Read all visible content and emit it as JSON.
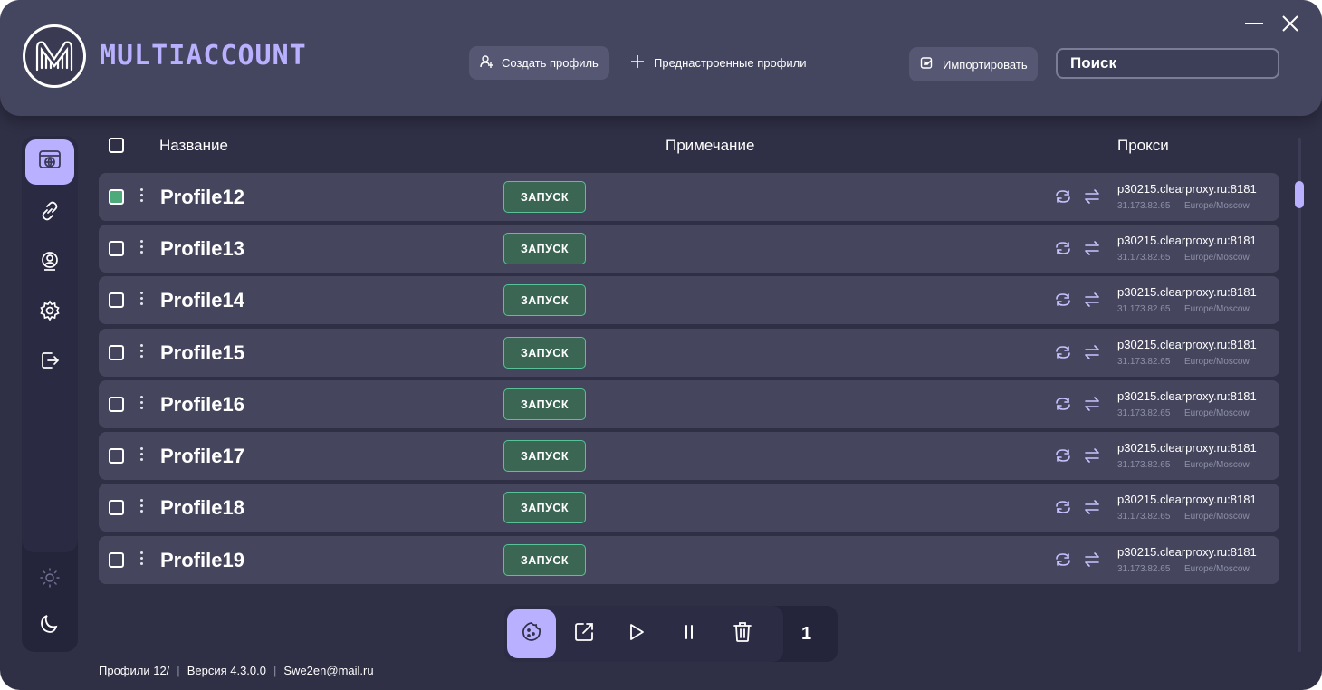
{
  "app": {
    "logo_icon": "fingerprint-m-logo",
    "logo_text": "MULTIACCOUNT",
    "accent_color": "#b9b0ff",
    "launch_color": "#58c196"
  },
  "header": {
    "create_profile_label": "Создать профиль",
    "create_profile_icon": "user-plus-icon",
    "presets_label": "Преднастроенные профили",
    "presets_icon": "plus-icon",
    "import_label": "Импортировать",
    "import_icon": "import-icon",
    "search_placeholder": "Поиск"
  },
  "sidebar": {
    "items": [
      {
        "icon": "browser-globe-icon",
        "active": true
      },
      {
        "icon": "link-icon",
        "active": false
      },
      {
        "icon": "user-bubble-icon",
        "active": false
      },
      {
        "icon": "gear-icon",
        "active": false
      },
      {
        "icon": "logout-icon",
        "active": false
      }
    ],
    "theme": [
      {
        "icon": "sun-icon"
      },
      {
        "icon": "moon-icon"
      }
    ]
  },
  "table": {
    "columns": {
      "name": "Название",
      "note": "Примечание",
      "proxy": "Прокси"
    },
    "rows": [
      {
        "name": "Profile12",
        "checked": true,
        "launch": "ЗАПУСК",
        "proxy_host": "p30215.clearproxy.ru:8181",
        "proxy_ip": "31.173.82.65",
        "proxy_tz": "Europe/Moscow"
      },
      {
        "name": "Profile13",
        "checked": false,
        "launch": "ЗАПУСК",
        "proxy_host": "p30215.clearproxy.ru:8181",
        "proxy_ip": "31.173.82.65",
        "proxy_tz": "Europe/Moscow"
      },
      {
        "name": "Profile14",
        "checked": false,
        "launch": "ЗАПУСК",
        "proxy_host": "p30215.clearproxy.ru:8181",
        "proxy_ip": "31.173.82.65",
        "proxy_tz": "Europe/Moscow"
      },
      {
        "name": "Profile15",
        "checked": false,
        "launch": "ЗАПУСК",
        "proxy_host": "p30215.clearproxy.ru:8181",
        "proxy_ip": "31.173.82.65",
        "proxy_tz": "Europe/Moscow"
      },
      {
        "name": "Profile16",
        "checked": false,
        "launch": "ЗАПУСК",
        "proxy_host": "p30215.clearproxy.ru:8181",
        "proxy_ip": "31.173.82.65",
        "proxy_tz": "Europe/Moscow"
      },
      {
        "name": "Profile17",
        "checked": false,
        "launch": "ЗАПУСК",
        "proxy_host": "p30215.clearproxy.ru:8181",
        "proxy_ip": "31.173.82.65",
        "proxy_tz": "Europe/Moscow"
      },
      {
        "name": "Profile18",
        "checked": false,
        "launch": "ЗАПУСК",
        "proxy_host": "p30215.clearproxy.ru:8181",
        "proxy_ip": "31.173.82.65",
        "proxy_tz": "Europe/Moscow"
      },
      {
        "name": "Profile19",
        "checked": false,
        "launch": "ЗАПУСК",
        "proxy_host": "p30215.clearproxy.ru:8181",
        "proxy_ip": "31.173.82.65",
        "proxy_tz": "Europe/Moscow"
      }
    ]
  },
  "toolbar": {
    "buttons": [
      "cookie-icon",
      "external-link-icon",
      "play-icon",
      "pause-icon",
      "trash-icon"
    ],
    "selected_count": "1"
  },
  "footer": {
    "profiles": "Профили 12/",
    "version": "Версия 4.3.0.0",
    "email": "Swe2en@mail.ru"
  }
}
